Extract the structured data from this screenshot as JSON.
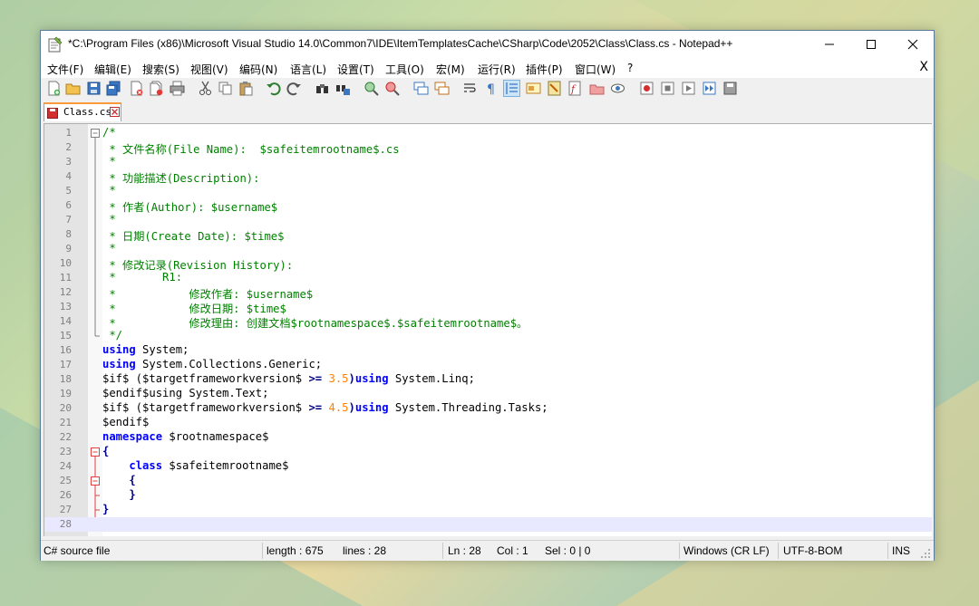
{
  "window": {
    "title": "*C:\\Program Files (x86)\\Microsoft Visual Studio 14.0\\Common7\\IDE\\ItemTemplatesCache\\CSharp\\Code\\2052\\Class\\Class.cs - Notepad++"
  },
  "menu": {
    "items": [
      "文件(F)",
      "编辑(E)",
      "搜索(S)",
      "视图(V)",
      "编码(N)",
      "语言(L)",
      "设置(T)",
      "工具(O)",
      "宏(M)",
      "运行(R)",
      "插件(P)",
      "窗口(W)",
      "?"
    ],
    "close": "X"
  },
  "toolbar": {
    "buttons": [
      "new-file",
      "open-file",
      "save",
      "save-all",
      "close",
      "close-all",
      "print",
      "cut",
      "copy",
      "paste",
      "undo",
      "redo",
      "find",
      "replace",
      "zoom-in",
      "zoom-out",
      "sync-vertical",
      "sync-horizontal",
      "word-wrap",
      "show-all-chars",
      "indent-guide",
      "udl",
      "document-map",
      "function-list",
      "folder-workspace",
      "monitoring",
      "record-macro",
      "stop-recording",
      "playback-macro",
      "run-macro-multiple",
      "save-macro"
    ]
  },
  "tab": {
    "label": "Class.cs"
  },
  "editor": {
    "current_line": 28,
    "lines": [
      {
        "n": "1",
        "parts": [
          {
            "t": "/*",
            "c": "c-comment"
          }
        ]
      },
      {
        "n": "2",
        "parts": [
          {
            "t": " * 文件名称(File Name):  $safeitemrootname$.cs",
            "c": "c-comment"
          }
        ]
      },
      {
        "n": "3",
        "parts": [
          {
            "t": " *",
            "c": "c-comment"
          }
        ]
      },
      {
        "n": "4",
        "parts": [
          {
            "t": " * 功能描述(Description):",
            "c": "c-comment"
          }
        ]
      },
      {
        "n": "5",
        "parts": [
          {
            "t": " *",
            "c": "c-comment"
          }
        ]
      },
      {
        "n": "6",
        "parts": [
          {
            "t": " * 作者(Author): $username$",
            "c": "c-comment"
          }
        ]
      },
      {
        "n": "7",
        "parts": [
          {
            "t": " *",
            "c": "c-comment"
          }
        ]
      },
      {
        "n": "8",
        "parts": [
          {
            "t": " * 日期(Create Date): $time$",
            "c": "c-comment"
          }
        ]
      },
      {
        "n": "9",
        "parts": [
          {
            "t": " *",
            "c": "c-comment"
          }
        ]
      },
      {
        "n": "10",
        "parts": [
          {
            "t": " * 修改记录(Revision History):",
            "c": "c-comment"
          }
        ]
      },
      {
        "n": "11",
        "parts": [
          {
            "t": " *       R1:",
            "c": "c-comment"
          }
        ]
      },
      {
        "n": "12",
        "parts": [
          {
            "t": " *           修改作者: $username$",
            "c": "c-comment"
          }
        ]
      },
      {
        "n": "13",
        "parts": [
          {
            "t": " *           修改日期: $time$",
            "c": "c-comment"
          }
        ]
      },
      {
        "n": "14",
        "parts": [
          {
            "t": " *           修改理由: 创建文档$rootnamespace$.$safeitemrootname$。",
            "c": "c-comment"
          }
        ]
      },
      {
        "n": "15",
        "parts": [
          {
            "t": " */",
            "c": "c-comment"
          }
        ]
      },
      {
        "n": "16",
        "parts": [
          {
            "t": "using",
            "c": "c-kw"
          },
          {
            "t": " System;",
            "c": ""
          }
        ]
      },
      {
        "n": "17",
        "parts": [
          {
            "t": "using",
            "c": "c-kw"
          },
          {
            "t": " System.Collections.Generic;",
            "c": ""
          }
        ]
      },
      {
        "n": "18",
        "parts": [
          {
            "t": "$if$ ($targetframeworkversion$ ",
            "c": ""
          },
          {
            "t": ">=",
            "c": "c-op"
          },
          {
            "t": " ",
            "c": ""
          },
          {
            "t": "3.5",
            "c": "c-num"
          },
          {
            "t": ")",
            "c": "c-op"
          },
          {
            "t": "using",
            "c": "c-kw"
          },
          {
            "t": " System.Linq;",
            "c": ""
          }
        ]
      },
      {
        "n": "19",
        "parts": [
          {
            "t": "$endif$using System.Text;",
            "c": ""
          }
        ]
      },
      {
        "n": "20",
        "parts": [
          {
            "t": "$if$ ($targetframeworkversion$ ",
            "c": ""
          },
          {
            "t": ">=",
            "c": "c-op"
          },
          {
            "t": " ",
            "c": ""
          },
          {
            "t": "4.5",
            "c": "c-num"
          },
          {
            "t": ")",
            "c": "c-op"
          },
          {
            "t": "using",
            "c": "c-kw"
          },
          {
            "t": " System.Threading.Tasks;",
            "c": ""
          }
        ]
      },
      {
        "n": "21",
        "parts": [
          {
            "t": "$endif$",
            "c": ""
          }
        ]
      },
      {
        "n": "22",
        "parts": [
          {
            "t": "namespace",
            "c": "c-kw"
          },
          {
            "t": " $rootnamespace$",
            "c": ""
          }
        ]
      },
      {
        "n": "23",
        "parts": [
          {
            "t": "{",
            "c": "c-op"
          }
        ]
      },
      {
        "n": "24",
        "parts": [
          {
            "t": "    ",
            "c": ""
          },
          {
            "t": "class",
            "c": "c-kw"
          },
          {
            "t": " $safeitemrootname$",
            "c": ""
          }
        ]
      },
      {
        "n": "25",
        "parts": [
          {
            "t": "    ",
            "c": ""
          },
          {
            "t": "{",
            "c": "c-op"
          }
        ]
      },
      {
        "n": "26",
        "parts": [
          {
            "t": "    ",
            "c": ""
          },
          {
            "t": "}",
            "c": "c-op"
          }
        ]
      },
      {
        "n": "27",
        "parts": [
          {
            "t": "}",
            "c": "c-op"
          }
        ]
      },
      {
        "n": "28",
        "parts": [
          {
            "t": "",
            "c": ""
          }
        ]
      }
    ]
  },
  "status": {
    "file_type": "C# source file",
    "length": "length : 675",
    "lines": "lines : 28",
    "ln": "Ln : 28",
    "col": "Col : 1",
    "sel": "Sel : 0 | 0",
    "eol": "Windows (CR LF)",
    "encoding": "UTF-8-BOM",
    "mode": "INS"
  },
  "colors": {
    "comment": "#008000",
    "keyword": "#0000ff",
    "number": "#ff8000",
    "operator": "#000080",
    "fold_red": "#e04040",
    "tab_accent": "#fa9a3c"
  }
}
